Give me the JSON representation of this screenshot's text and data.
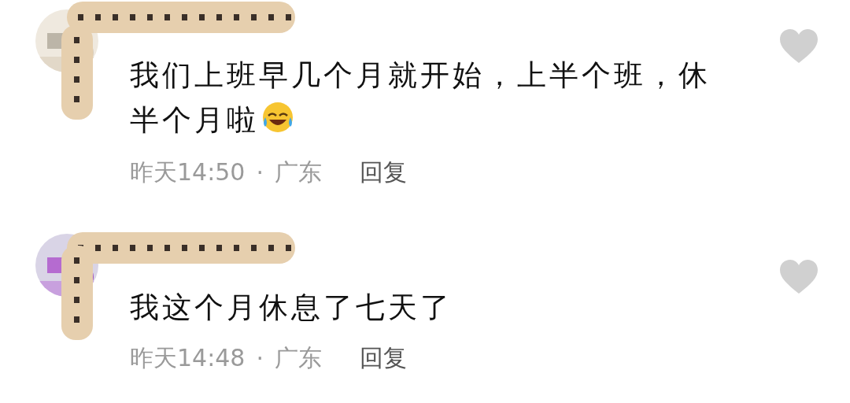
{
  "comments": [
    {
      "text": "我们上班早几个月就开始，上半个班，休半个月啦",
      "emoji": true,
      "time": "昨天14:50",
      "separator": "·",
      "location": "广东",
      "reply": "回复"
    },
    {
      "text": "我这个月休息了七天了",
      "emoji": false,
      "time": "昨天14:48",
      "separator": "·",
      "location": "广东",
      "reply": "回复"
    }
  ]
}
